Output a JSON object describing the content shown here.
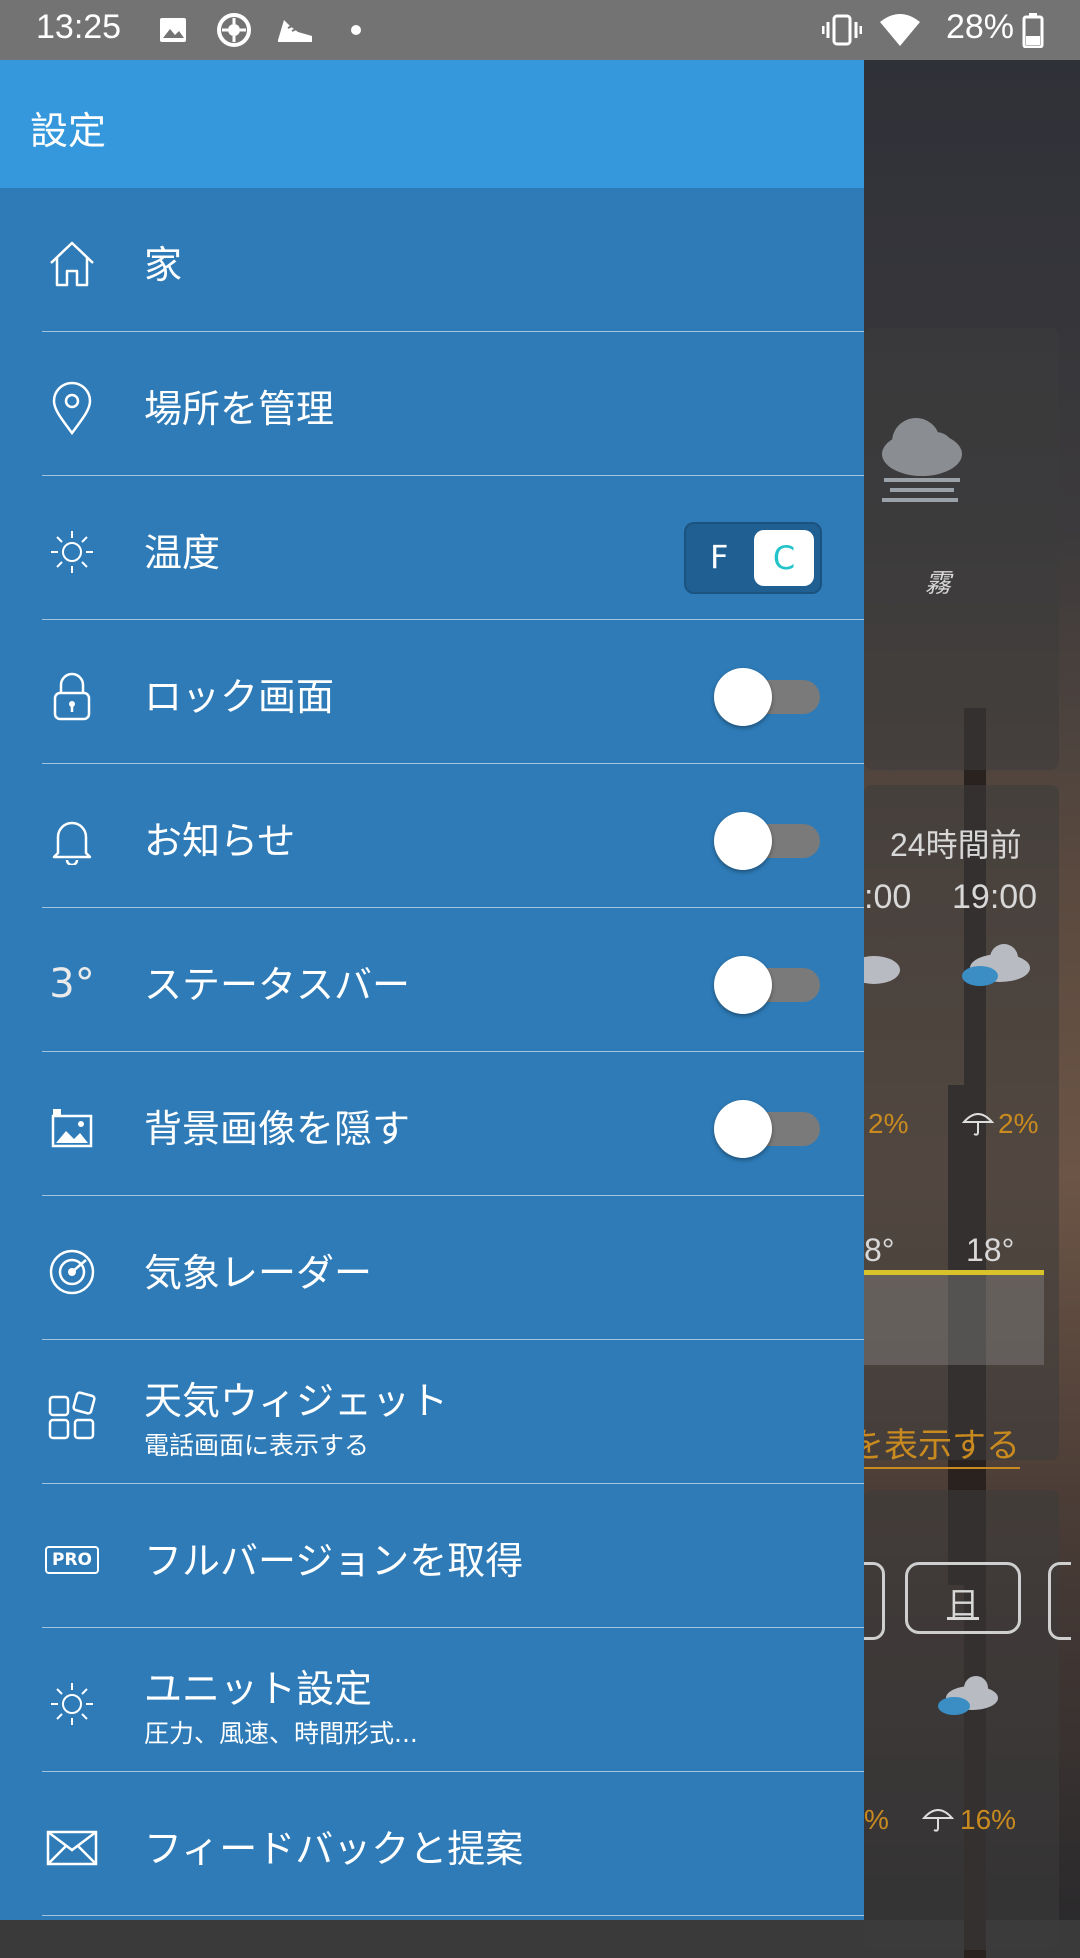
{
  "status_bar": {
    "time": "13:25",
    "battery": "28%",
    "icons": [
      "image-icon",
      "compass-icon",
      "shoe-icon",
      "dot-icon",
      "vibrate-icon",
      "wifi-icon",
      "battery-icon"
    ]
  },
  "drawer": {
    "title": "設定",
    "items": [
      {
        "label": "家",
        "icon": "home-icon"
      },
      {
        "label": "場所を管理",
        "icon": "location-pin-icon"
      },
      {
        "label": "温度",
        "icon": "sun-icon",
        "unit_toggle": {
          "f": "F",
          "c": "C",
          "selected": "C"
        }
      },
      {
        "label": "ロック画面",
        "icon": "lock-icon",
        "switch_on": false
      },
      {
        "label": "お知らせ",
        "icon": "bell-icon",
        "switch_on": false
      },
      {
        "label": "ステータスバー",
        "icon": "temperature-3-icon",
        "icon_text": "3°",
        "switch_on": false
      },
      {
        "label": "背景画像を隠す",
        "icon": "image-lock-icon",
        "switch_on": false
      },
      {
        "label": "気象レーダー",
        "icon": "radar-icon"
      },
      {
        "label": "天気ウィジェット",
        "sub": "電話画面に表示する",
        "icon": "widgets-icon"
      },
      {
        "label": "フルバージョンを取得",
        "icon": "pro-badge-icon",
        "icon_text": "PRO"
      },
      {
        "label": "ユニット設定",
        "sub": "圧力、風速、時間形式...",
        "icon": "settings-sun-icon"
      },
      {
        "label": "フィードバックと提案",
        "icon": "mail-icon"
      }
    ]
  },
  "background": {
    "condition": "霧",
    "hourly_header": "24時間前",
    "times": [
      ":00",
      "19:00"
    ],
    "precip": [
      "2%",
      "2%"
    ],
    "temps": [
      "8°",
      "18°"
    ],
    "link": "を表示する",
    "day": "日",
    "precip2": [
      "%",
      "16%"
    ]
  },
  "colors": {
    "drawer_bg": "#2e7bb7",
    "header_bg": "#3598dc",
    "status_bar_bg": "#737373",
    "accent_orange": "#c98a1f",
    "toggle_c": "#22c3c9"
  }
}
